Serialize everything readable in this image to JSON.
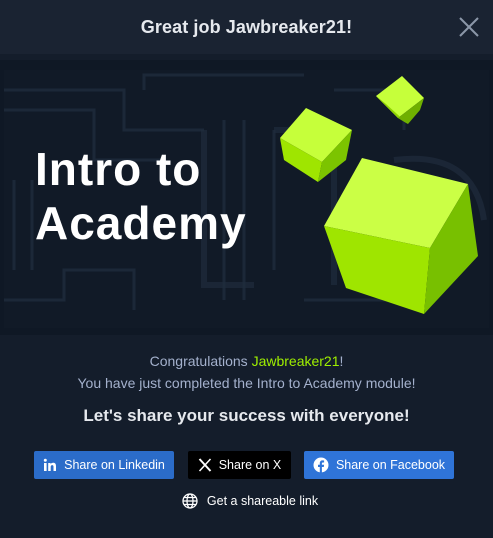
{
  "header": {
    "title": "Great job Jawbreaker21!"
  },
  "banner": {
    "line1": "Intro to",
    "line2": "Academy"
  },
  "message": {
    "congrats_prefix": "Congratulations ",
    "username": "Jawbreaker21",
    "congrats_suffix": "!",
    "completed": "You have just completed the Intro to Academy module!"
  },
  "share": {
    "heading": "Let's share your success with everyone!",
    "linkedin_label": "Share on Linkedin",
    "x_label": "Share on X",
    "facebook_label": "Share on Facebook",
    "link_label": "Get a shareable link"
  },
  "icons": {
    "close": "close-icon",
    "linkedin": "linkedin-icon",
    "x": "x-icon",
    "facebook": "facebook-icon",
    "link": "globe-icon"
  },
  "colors": {
    "accent": "#9fef00",
    "background": "#141d2b",
    "linkedin": "#2b6cc9",
    "facebook": "#2f74d8",
    "x": "#000000"
  }
}
